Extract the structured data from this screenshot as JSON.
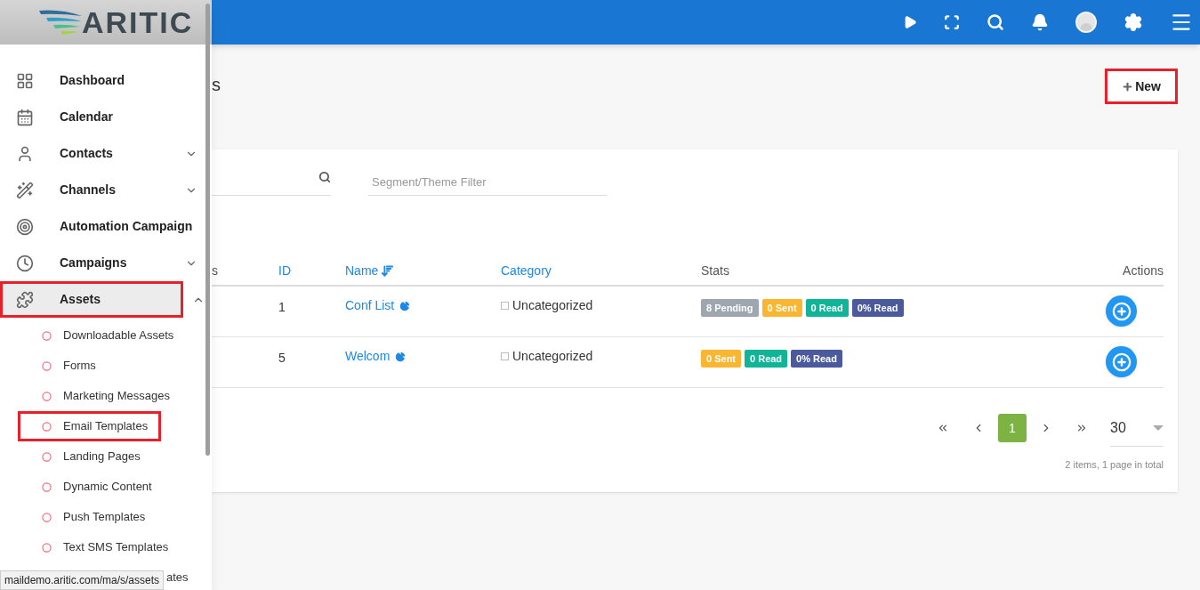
{
  "logo": {
    "text": "ARITIC"
  },
  "sidebar": {
    "items": [
      {
        "label": "Dashboard",
        "selected": false,
        "highlighted": false
      },
      {
        "label": "Calendar",
        "selected": false,
        "highlighted": false
      },
      {
        "label": "Contacts",
        "selected": false,
        "highlighted": false,
        "expanded": false
      },
      {
        "label": "Channels",
        "selected": false,
        "highlighted": false,
        "expanded": false
      },
      {
        "label": "Automation Campaign",
        "selected": false,
        "highlighted": false
      },
      {
        "label": "Campaigns",
        "selected": false,
        "highlighted": false,
        "expanded": false
      },
      {
        "label": "Assets",
        "selected": true,
        "highlighted": true,
        "expanded": true,
        "children": [
          {
            "label": "Downloadable Assets",
            "kind": "link",
            "highlighted": false
          },
          {
            "label": "Forms",
            "kind": "link",
            "highlighted": false
          },
          {
            "label": "Marketing Messages",
            "kind": "link",
            "highlighted": false
          },
          {
            "label": "Email Templates",
            "kind": "link",
            "highlighted": true
          },
          {
            "label": "Landing Pages",
            "kind": "link",
            "highlighted": false
          },
          {
            "label": "Dynamic Content",
            "kind": "link",
            "highlighted": false
          },
          {
            "label": "Push Templates",
            "kind": "link",
            "highlighted": false
          },
          {
            "label": "Text SMS Templates",
            "kind": "link",
            "highlighted": false
          },
          {
            "label": "ates",
            "kind": "covered"
          }
        ]
      }
    ]
  },
  "status_url": "maildemo.aritic.com/ma/s/assets",
  "page_title": "s",
  "new_button": {
    "label": "New",
    "highlighted": true
  },
  "filter": {
    "placeholder": "Segment/Theme Filter"
  },
  "table": {
    "columns": [
      {
        "label": "s",
        "sortable": false
      },
      {
        "label": "ID",
        "sortable": true
      },
      {
        "label": "Name",
        "sortable": true,
        "sorted": true
      },
      {
        "label": "Category",
        "sortable": true
      },
      {
        "label": "Stats",
        "sortable": false
      },
      {
        "label": "Actions",
        "sortable": false
      }
    ],
    "rows": [
      {
        "id": "1",
        "name": "Conf List",
        "checked": false,
        "category": "Uncategorized",
        "stats": [
          {
            "text": "8 Pending",
            "color": "#9ea7b0"
          },
          {
            "text": "0 Sent",
            "color": "#fbb631"
          },
          {
            "text": "0 Read",
            "color": "#10b497"
          },
          {
            "text": "0% Read",
            "color": "#4b5a9c"
          }
        ]
      },
      {
        "id": "5",
        "name": "Welcom",
        "checked": false,
        "category": "Uncategorized",
        "stats": [
          {
            "text": "0 Sent",
            "color": "#fbb631"
          },
          {
            "text": "0 Read",
            "color": "#10b497"
          },
          {
            "text": "0% Read",
            "color": "#4b5a9c"
          }
        ]
      }
    ]
  },
  "pagination": {
    "pages": [
      {
        "label": "1",
        "selected": true
      }
    ],
    "per_page": "30",
    "summary": "2 items, 1 page in total"
  }
}
